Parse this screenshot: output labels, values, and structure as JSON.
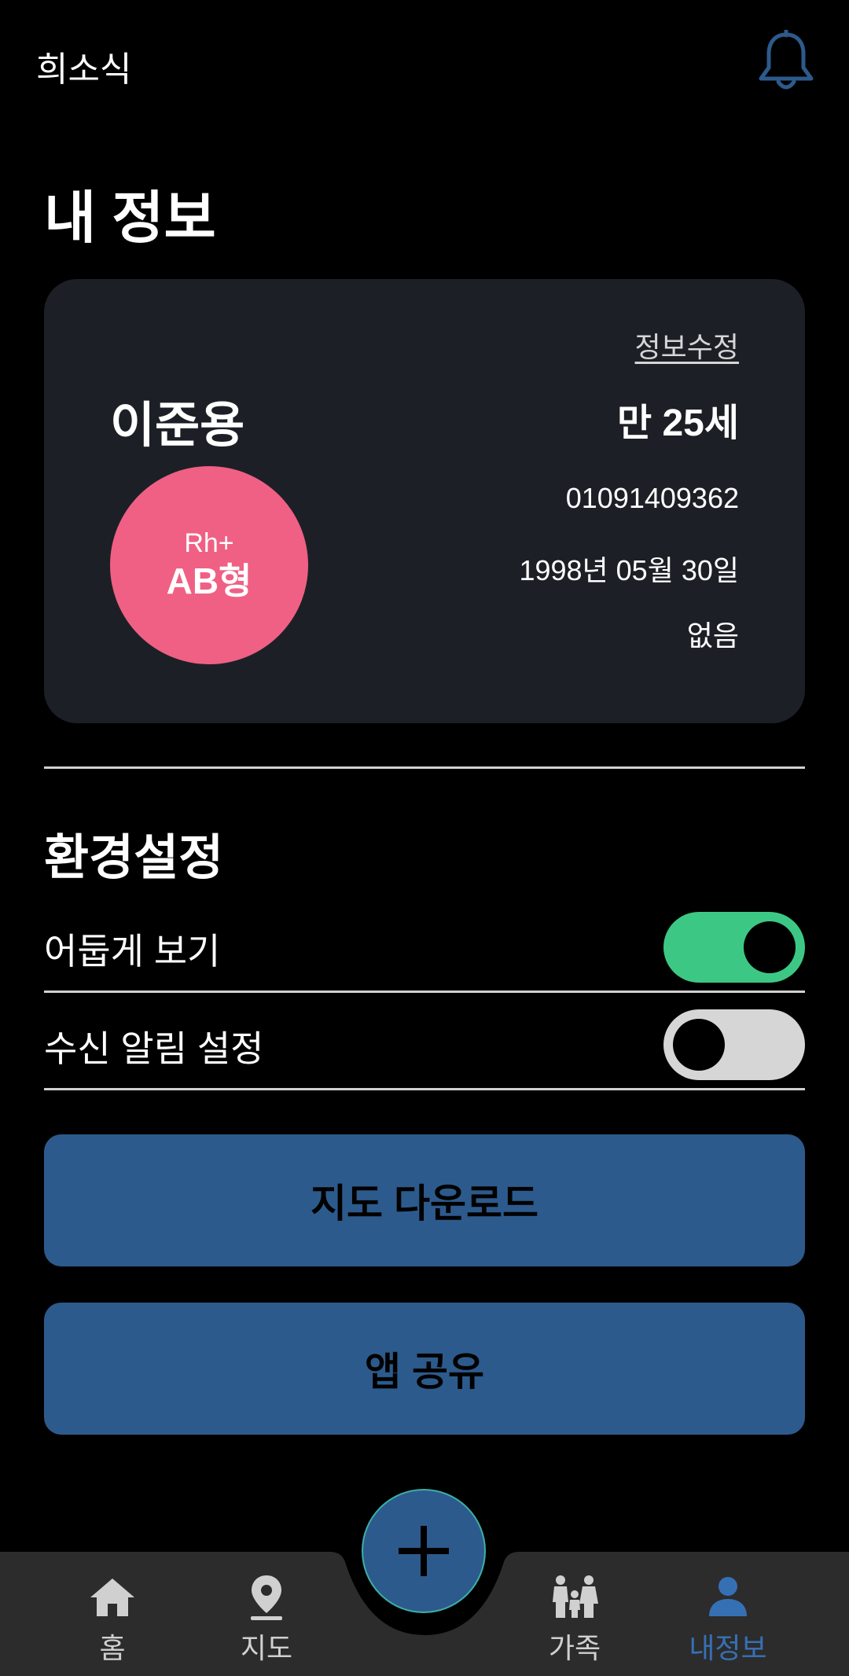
{
  "header": {
    "app_title": "희소식",
    "bell_icon": "bell-icon",
    "bell_color": "#2d5a8c"
  },
  "page": {
    "title": "내 정보"
  },
  "profile": {
    "edit_label": "정보수정",
    "name": "이준용",
    "age": "만 25세",
    "rh": "Rh+",
    "blood_type": "AB형",
    "phone": "01091409362",
    "birthdate": "1998년 05월 30일",
    "disease": "없음",
    "blood_circle_color": "#f06084"
  },
  "settings": {
    "title": "환경설정",
    "items": [
      {
        "label": "어둡게 보기",
        "enabled": true
      },
      {
        "label": "수신 알림 설정",
        "enabled": false
      }
    ],
    "toggle_on_color": "#3cc884",
    "toggle_off_color": "#d6d6d6"
  },
  "actions": {
    "map_download": "지도 다운로드",
    "share_app": "앱 공유",
    "button_color": "#2d5a8c"
  },
  "nav": {
    "items": [
      {
        "label": "홈",
        "icon": "home-icon"
      },
      {
        "label": "지도",
        "icon": "map-pin-icon"
      },
      {
        "label": "가족",
        "icon": "family-icon"
      },
      {
        "label": "내정보",
        "icon": "person-icon",
        "active": true
      }
    ],
    "fab_icon": "plus-icon",
    "active_color": "#3670b4"
  }
}
